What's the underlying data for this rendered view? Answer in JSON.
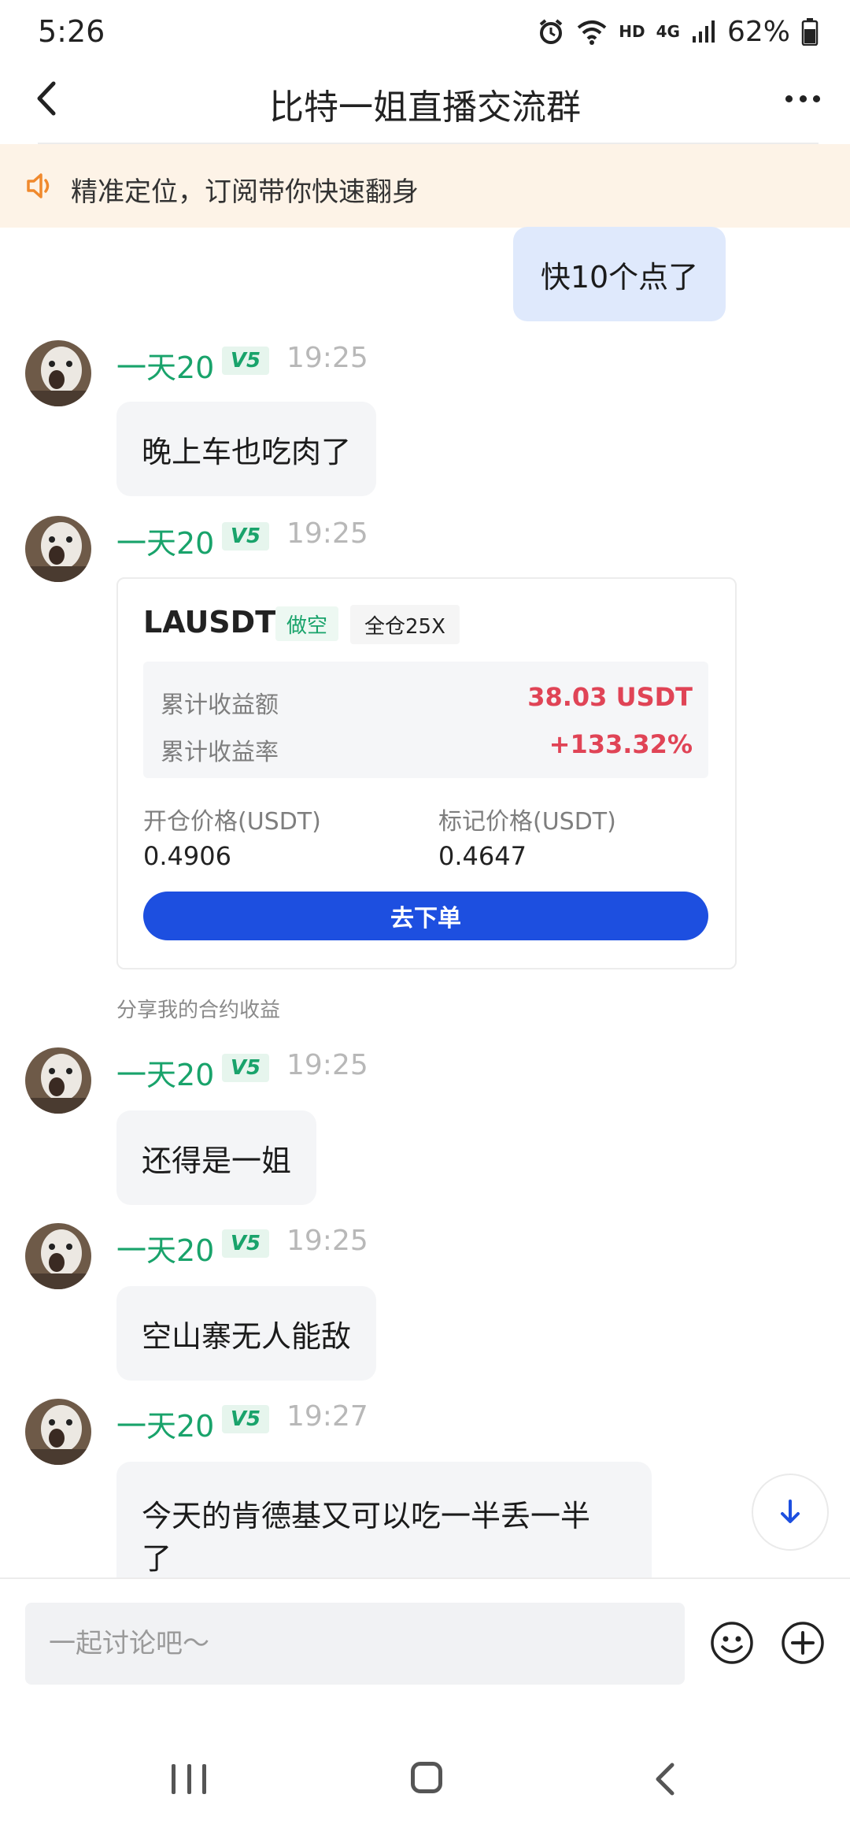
{
  "status_bar": {
    "time": "5:26",
    "network": "HD",
    "network_type": "4G",
    "battery": "62%"
  },
  "header": {
    "title": "比特一姐直播交流群",
    "back_icon": "chevron-left-icon",
    "more_icon": "more-horizontal-icon"
  },
  "notice": {
    "icon": "speaker-icon",
    "text": "精准定位，订阅带你快速翻身"
  },
  "own_message": {
    "text": "快10个点了"
  },
  "messages": [
    {
      "user": "一天20",
      "level": "V5",
      "time": "19:25",
      "text": "晚上车也吃肉了"
    },
    {
      "user": "一天20",
      "level": "V5",
      "time": "19:25"
    },
    {
      "user": "一天20",
      "level": "V5",
      "time": "19:25",
      "text": "还得是一姐"
    },
    {
      "user": "一天20",
      "level": "V5",
      "time": "19:25",
      "text": "空山寨无人能敌"
    },
    {
      "user": "一天20",
      "level": "V5",
      "time": "19:27",
      "text_line1": "今天的肯德基又可以吃一半丢一半",
      "text_line2": "了"
    }
  ],
  "card": {
    "symbol": "LAUSDT",
    "direction": "做空",
    "leverage": "全仓25X",
    "profit_label": "累计收益额",
    "profit_value": "38.03 USDT",
    "rate_label": "累计收益率",
    "rate_value": "+133.32%",
    "open_price_label": "开仓价格(USDT)",
    "open_price_value": "0.4906",
    "mark_price_label": "标记价格(USDT)",
    "mark_price_value": "0.4647",
    "button_label": "去下单",
    "caption": "分享我的合约收益"
  },
  "input_bar": {
    "placeholder": "一起讨论吧～",
    "emoji_icon": "smile-icon",
    "plus_icon": "plus-circle-icon"
  },
  "colors": {
    "accent_green": "#19a36b",
    "profit_red": "#e04456",
    "button_blue": "#1d4fe0",
    "notice_bg": "#fdf3e7",
    "own_bubble": "#dfe9fc"
  }
}
